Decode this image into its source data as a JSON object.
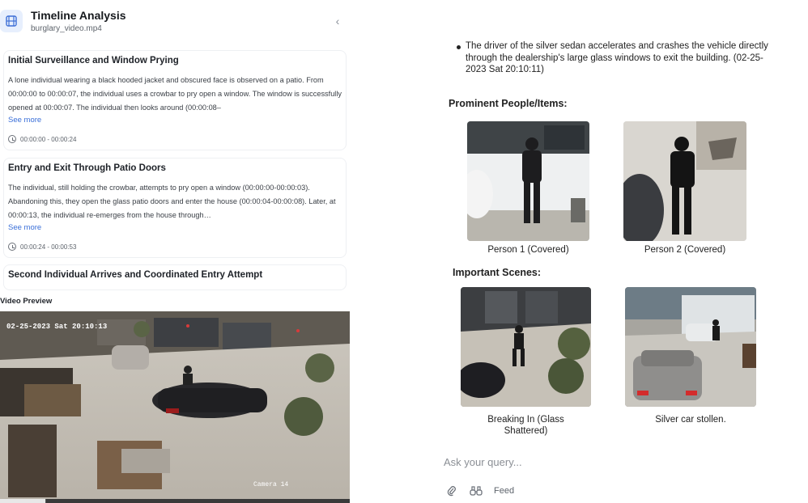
{
  "header": {
    "title": "Timeline Analysis",
    "subtitle": "burglary_video.mp4",
    "collapse_glyph": "‹",
    "app_icon": "film-icon"
  },
  "cards": [
    {
      "title": "Initial Surveillance and Window Prying",
      "text": "A lone individual wearing a black hooded jacket and obscured face is observed on a patio. From 00:00:00 to 00:00:07, the individual uses a crowbar to pry open a window. The window is successfully opened at 00:00:07. The individual then looks around (00:00:08–",
      "see_more": "See more",
      "time": "00:00:00 - 00:00:24"
    },
    {
      "title": "Entry and Exit Through Patio Doors",
      "text": "The individual, still holding the crowbar, attempts to pry open a window (00:00:00-00:00:03). Abandoning this, they open the glass patio doors and enter the house (00:00:04-00:00:08). Later, at 00:00:13, the individual re-emerges from the house through…",
      "see_more": "See more",
      "time": "00:00:24 - 00:00:53"
    },
    {
      "title": "Second Individual Arrives and Coordinated Entry Attempt"
    }
  ],
  "video": {
    "label": "Video Preview",
    "timestamp": "02-25-2023 Sat 20:10:13",
    "camera": "Camera 14",
    "progress": 0.13
  },
  "report": {
    "bullet": "The driver of the silver sedan accelerates and crashes the vehicle directly through the dealership's large glass windows to exit the building. (02-25-2023 Sat 20:10:11)",
    "people_heading": "Prominent People/Items:",
    "people": [
      {
        "caption": "Person 1 (Covered)"
      },
      {
        "caption": "Person 2 (Covered)"
      }
    ],
    "scenes_heading": "Important Scenes:",
    "scenes": [
      {
        "caption_line1": "Breaking In (Glass",
        "caption_line2": "Shattered)"
      },
      {
        "caption_line1": "Silver car stollen.",
        "caption_line2": ""
      }
    ]
  },
  "composer": {
    "placeholder": "Ask your query...",
    "attach_icon": "paperclip-icon",
    "binoculars_icon": "binoculars-icon",
    "feed_label": "Feed"
  },
  "colors": {
    "accent": "#3a6fd8",
    "app_icon_bg": "#e7effd"
  }
}
